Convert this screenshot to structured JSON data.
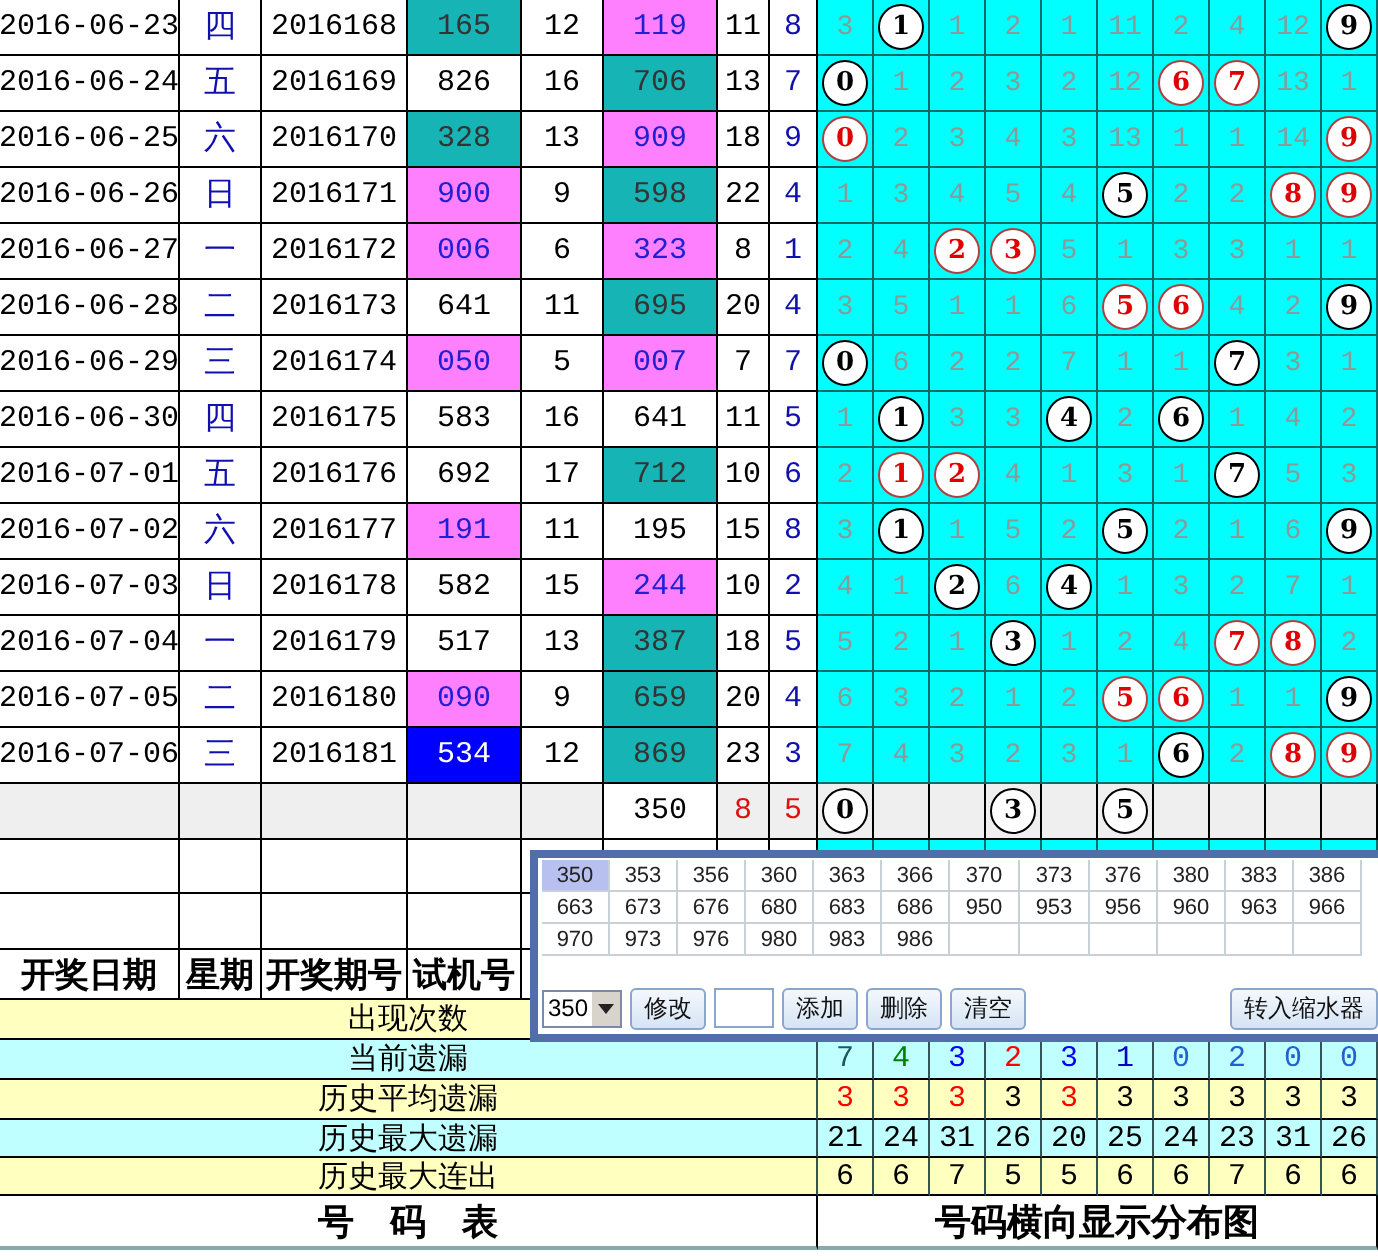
{
  "rows": [
    {
      "date": "2016-06-23",
      "weekday": "四",
      "issue": "2016168",
      "trial": {
        "text": "165",
        "color": "#16b4b4"
      },
      "sum": "12",
      "draw": {
        "text": "119",
        "color": "#ff80ff"
      },
      "span": "11",
      "tail": "8",
      "cells": [
        {
          "kind": "miss",
          "text": "3"
        },
        {
          "kind": "ball",
          "text": "1",
          "red": false
        },
        {
          "kind": "miss",
          "text": "1"
        },
        {
          "kind": "miss",
          "text": "2"
        },
        {
          "kind": "miss",
          "text": "1"
        },
        {
          "kind": "miss",
          "text": "11"
        },
        {
          "kind": "miss",
          "text": "2"
        },
        {
          "kind": "miss",
          "text": "4"
        },
        {
          "kind": "miss",
          "text": "12"
        },
        {
          "kind": "ball",
          "text": "9",
          "red": false
        }
      ]
    },
    {
      "date": "2016-06-24",
      "weekday": "五",
      "issue": "2016169",
      "trial": {
        "text": "826"
      },
      "sum": "16",
      "draw": {
        "text": "706",
        "color": "#16b4b4"
      },
      "span": "13",
      "tail": "7",
      "cells": [
        {
          "kind": "ball",
          "text": "0",
          "red": false
        },
        {
          "kind": "miss",
          "text": "1"
        },
        {
          "kind": "miss",
          "text": "2"
        },
        {
          "kind": "miss",
          "text": "3"
        },
        {
          "kind": "miss",
          "text": "2"
        },
        {
          "kind": "miss",
          "text": "12"
        },
        {
          "kind": "ball",
          "text": "6",
          "red": true
        },
        {
          "kind": "ball",
          "text": "7",
          "red": true
        },
        {
          "kind": "miss",
          "text": "13"
        },
        {
          "kind": "miss",
          "text": "1"
        }
      ]
    },
    {
      "date": "2016-06-25",
      "weekday": "六",
      "issue": "2016170",
      "trial": {
        "text": "328",
        "color": "#16b4b4"
      },
      "sum": "13",
      "draw": {
        "text": "909",
        "color": "#ff80ff"
      },
      "span": "18",
      "tail": "9",
      "cells": [
        {
          "kind": "ball",
          "text": "0",
          "red": true
        },
        {
          "kind": "miss",
          "text": "2"
        },
        {
          "kind": "miss",
          "text": "3"
        },
        {
          "kind": "miss",
          "text": "4"
        },
        {
          "kind": "miss",
          "text": "3"
        },
        {
          "kind": "miss",
          "text": "13"
        },
        {
          "kind": "miss",
          "text": "1"
        },
        {
          "kind": "miss",
          "text": "1"
        },
        {
          "kind": "miss",
          "text": "14"
        },
        {
          "kind": "ball",
          "text": "9",
          "red": true
        }
      ]
    },
    {
      "date": "2016-06-26",
      "weekday": "日",
      "issue": "2016171",
      "trial": {
        "text": "900",
        "color": "#ff80ff"
      },
      "sum": "9",
      "draw": {
        "text": "598",
        "color": "#16b4b4"
      },
      "span": "22",
      "tail": "4",
      "cells": [
        {
          "kind": "miss",
          "text": "1"
        },
        {
          "kind": "miss",
          "text": "3"
        },
        {
          "kind": "miss",
          "text": "4"
        },
        {
          "kind": "miss",
          "text": "5"
        },
        {
          "kind": "miss",
          "text": "4"
        },
        {
          "kind": "ball",
          "text": "5",
          "red": false
        },
        {
          "kind": "miss",
          "text": "2"
        },
        {
          "kind": "miss",
          "text": "2"
        },
        {
          "kind": "ball",
          "text": "8",
          "red": true
        },
        {
          "kind": "ball",
          "text": "9",
          "red": true
        }
      ]
    },
    {
      "date": "2016-06-27",
      "weekday": "一",
      "issue": "2016172",
      "trial": {
        "text": "006",
        "color": "#ff80ff"
      },
      "sum": "6",
      "draw": {
        "text": "323",
        "color": "#ff80ff"
      },
      "span": "8",
      "tail": "1",
      "cells": [
        {
          "kind": "miss",
          "text": "2"
        },
        {
          "kind": "miss",
          "text": "4"
        },
        {
          "kind": "ball",
          "text": "2",
          "red": true
        },
        {
          "kind": "ball",
          "text": "3",
          "red": true
        },
        {
          "kind": "miss",
          "text": "5"
        },
        {
          "kind": "miss",
          "text": "1"
        },
        {
          "kind": "miss",
          "text": "3"
        },
        {
          "kind": "miss",
          "text": "3"
        },
        {
          "kind": "miss",
          "text": "1"
        },
        {
          "kind": "miss",
          "text": "1"
        }
      ]
    },
    {
      "date": "2016-06-28",
      "weekday": "二",
      "issue": "2016173",
      "trial": {
        "text": "641"
      },
      "sum": "11",
      "draw": {
        "text": "695",
        "color": "#16b4b4"
      },
      "span": "20",
      "tail": "4",
      "cells": [
        {
          "kind": "miss",
          "text": "3"
        },
        {
          "kind": "miss",
          "text": "5"
        },
        {
          "kind": "miss",
          "text": "1"
        },
        {
          "kind": "miss",
          "text": "1"
        },
        {
          "kind": "miss",
          "text": "6"
        },
        {
          "kind": "ball",
          "text": "5",
          "red": true
        },
        {
          "kind": "ball",
          "text": "6",
          "red": true
        },
        {
          "kind": "miss",
          "text": "4"
        },
        {
          "kind": "miss",
          "text": "2"
        },
        {
          "kind": "ball",
          "text": "9",
          "red": false
        }
      ]
    },
    {
      "date": "2016-06-29",
      "weekday": "三",
      "issue": "2016174",
      "trial": {
        "text": "050",
        "color": "#ff80ff"
      },
      "sum": "5",
      "draw": {
        "text": "007",
        "color": "#ff80ff"
      },
      "span": "7",
      "tail": "7",
      "cells": [
        {
          "kind": "ball",
          "text": "0",
          "red": false
        },
        {
          "kind": "miss",
          "text": "6"
        },
        {
          "kind": "miss",
          "text": "2"
        },
        {
          "kind": "miss",
          "text": "2"
        },
        {
          "kind": "miss",
          "text": "7"
        },
        {
          "kind": "miss",
          "text": "1"
        },
        {
          "kind": "miss",
          "text": "1"
        },
        {
          "kind": "ball",
          "text": "7",
          "red": false
        },
        {
          "kind": "miss",
          "text": "3"
        },
        {
          "kind": "miss",
          "text": "1"
        }
      ]
    },
    {
      "date": "2016-06-30",
      "weekday": "四",
      "issue": "2016175",
      "trial": {
        "text": "583"
      },
      "sum": "16",
      "draw": {
        "text": "641"
      },
      "span": "11",
      "tail": "5",
      "cells": [
        {
          "kind": "miss",
          "text": "1"
        },
        {
          "kind": "ball",
          "text": "1",
          "red": false
        },
        {
          "kind": "miss",
          "text": "3"
        },
        {
          "kind": "miss",
          "text": "3"
        },
        {
          "kind": "ball",
          "text": "4",
          "red": false
        },
        {
          "kind": "miss",
          "text": "2"
        },
        {
          "kind": "ball",
          "text": "6",
          "red": false
        },
        {
          "kind": "miss",
          "text": "1"
        },
        {
          "kind": "miss",
          "text": "4"
        },
        {
          "kind": "miss",
          "text": "2"
        }
      ]
    },
    {
      "date": "2016-07-01",
      "weekday": "五",
      "issue": "2016176",
      "trial": {
        "text": "692"
      },
      "sum": "17",
      "draw": {
        "text": "712",
        "color": "#16b4b4"
      },
      "span": "10",
      "tail": "6",
      "cells": [
        {
          "kind": "miss",
          "text": "2"
        },
        {
          "kind": "ball",
          "text": "1",
          "red": true
        },
        {
          "kind": "ball",
          "text": "2",
          "red": true
        },
        {
          "kind": "miss",
          "text": "4"
        },
        {
          "kind": "miss",
          "text": "1"
        },
        {
          "kind": "miss",
          "text": "3"
        },
        {
          "kind": "miss",
          "text": "1"
        },
        {
          "kind": "ball",
          "text": "7",
          "red": false
        },
        {
          "kind": "miss",
          "text": "5"
        },
        {
          "kind": "miss",
          "text": "3"
        }
      ]
    },
    {
      "date": "2016-07-02",
      "weekday": "六",
      "issue": "2016177",
      "trial": {
        "text": "191",
        "color": "#ff80ff"
      },
      "sum": "11",
      "draw": {
        "text": "195"
      },
      "span": "15",
      "tail": "8",
      "cells": [
        {
          "kind": "miss",
          "text": "3"
        },
        {
          "kind": "ball",
          "text": "1",
          "red": false
        },
        {
          "kind": "miss",
          "text": "1"
        },
        {
          "kind": "miss",
          "text": "5"
        },
        {
          "kind": "miss",
          "text": "2"
        },
        {
          "kind": "ball",
          "text": "5",
          "red": false
        },
        {
          "kind": "miss",
          "text": "2"
        },
        {
          "kind": "miss",
          "text": "1"
        },
        {
          "kind": "miss",
          "text": "6"
        },
        {
          "kind": "ball",
          "text": "9",
          "red": false
        }
      ]
    },
    {
      "date": "2016-07-03",
      "weekday": "日",
      "issue": "2016178",
      "trial": {
        "text": "582"
      },
      "sum": "15",
      "draw": {
        "text": "244",
        "color": "#ff80ff"
      },
      "span": "10",
      "tail": "2",
      "cells": [
        {
          "kind": "miss",
          "text": "4"
        },
        {
          "kind": "miss",
          "text": "1"
        },
        {
          "kind": "ball",
          "text": "2",
          "red": false
        },
        {
          "kind": "miss",
          "text": "6"
        },
        {
          "kind": "ball",
          "text": "4",
          "red": false
        },
        {
          "kind": "miss",
          "text": "1"
        },
        {
          "kind": "miss",
          "text": "3"
        },
        {
          "kind": "miss",
          "text": "2"
        },
        {
          "kind": "miss",
          "text": "7"
        },
        {
          "kind": "miss",
          "text": "1"
        }
      ]
    },
    {
      "date": "2016-07-04",
      "weekday": "一",
      "issue": "2016179",
      "trial": {
        "text": "517"
      },
      "sum": "13",
      "draw": {
        "text": "387",
        "color": "#16b4b4"
      },
      "span": "18",
      "tail": "5",
      "cells": [
        {
          "kind": "miss",
          "text": "5"
        },
        {
          "kind": "miss",
          "text": "2"
        },
        {
          "kind": "miss",
          "text": "1"
        },
        {
          "kind": "ball",
          "text": "3",
          "red": false
        },
        {
          "kind": "miss",
          "text": "1"
        },
        {
          "kind": "miss",
          "text": "2"
        },
        {
          "kind": "miss",
          "text": "4"
        },
        {
          "kind": "ball",
          "text": "7",
          "red": true
        },
        {
          "kind": "ball",
          "text": "8",
          "red": true
        },
        {
          "kind": "miss",
          "text": "2"
        }
      ]
    },
    {
      "date": "2016-07-05",
      "weekday": "二",
      "issue": "2016180",
      "trial": {
        "text": "090",
        "color": "#ff80ff"
      },
      "sum": "9",
      "draw": {
        "text": "659",
        "color": "#16b4b4"
      },
      "span": "20",
      "tail": "4",
      "cells": [
        {
          "kind": "miss",
          "text": "6"
        },
        {
          "kind": "miss",
          "text": "3"
        },
        {
          "kind": "miss",
          "text": "2"
        },
        {
          "kind": "miss",
          "text": "1"
        },
        {
          "kind": "miss",
          "text": "2"
        },
        {
          "kind": "ball",
          "text": "5",
          "red": true
        },
        {
          "kind": "ball",
          "text": "6",
          "red": true
        },
        {
          "kind": "miss",
          "text": "1"
        },
        {
          "kind": "miss",
          "text": "1"
        },
        {
          "kind": "ball",
          "text": "9",
          "red": false
        }
      ]
    },
    {
      "date": "2016-07-06",
      "weekday": "三",
      "issue": "2016181",
      "trial": {
        "text": "534",
        "color": "#0000ff"
      },
      "sum": "12",
      "draw": {
        "text": "869",
        "color": "#16b4b4"
      },
      "span": "23",
      "tail": "3",
      "cells": [
        {
          "kind": "miss",
          "text": "7"
        },
        {
          "kind": "miss",
          "text": "4"
        },
        {
          "kind": "miss",
          "text": "3"
        },
        {
          "kind": "miss",
          "text": "2"
        },
        {
          "kind": "miss",
          "text": "3"
        },
        {
          "kind": "miss",
          "text": "1"
        },
        {
          "kind": "ball",
          "text": "6",
          "red": false
        },
        {
          "kind": "miss",
          "text": "2"
        },
        {
          "kind": "ball",
          "text": "8",
          "red": true
        },
        {
          "kind": "ball",
          "text": "9",
          "red": true
        }
      ]
    }
  ],
  "summary_row": {
    "draw": "350",
    "span": "8",
    "tail": "5",
    "cells": [
      {
        "kind": "ball",
        "text": "0",
        "red": false
      },
      {
        "kind": "empty"
      },
      {
        "kind": "empty"
      },
      {
        "kind": "ball",
        "text": "3",
        "red": false
      },
      {
        "kind": "empty"
      },
      {
        "kind": "ball",
        "text": "5",
        "red": false
      },
      {
        "kind": "empty"
      },
      {
        "kind": "empty"
      },
      {
        "kind": "empty"
      },
      {
        "kind": "empty"
      }
    ]
  },
  "headers": [
    "开奖日期",
    "星期",
    "开奖期号",
    "试机号"
  ],
  "stats": [
    {
      "label": "出现次数"
    },
    {
      "label": "当前遗漏",
      "values": [
        {
          "text": "7",
          "color": "#1a5a5a"
        },
        {
          "text": "4",
          "color": "#008000"
        },
        {
          "text": "3",
          "color": "#0000ff"
        },
        {
          "text": "2",
          "color": "#ff0000"
        },
        {
          "text": "3",
          "color": "#0000ff"
        },
        {
          "text": "1",
          "color": "#0000c0"
        },
        {
          "text": "0",
          "color": "#2060d0"
        },
        {
          "text": "2",
          "color": "#2060d0"
        },
        {
          "text": "0",
          "color": "#2060d0"
        },
        {
          "text": "0",
          "color": "#2060d0"
        }
      ]
    },
    {
      "label": "历史平均遗漏",
      "values": [
        {
          "text": "3",
          "color": "#ff0000"
        },
        {
          "text": "3",
          "color": "#ff0000"
        },
        {
          "text": "3",
          "color": "#ff0000"
        },
        {
          "text": "3",
          "color": "#000000"
        },
        {
          "text": "3",
          "color": "#ff0000"
        },
        {
          "text": "3",
          "color": "#000000"
        },
        {
          "text": "3",
          "color": "#000000"
        },
        {
          "text": "3",
          "color": "#000000"
        },
        {
          "text": "3",
          "color": "#000000"
        },
        {
          "text": "3",
          "color": "#000000"
        }
      ]
    },
    {
      "label": "历史最大遗漏",
      "values": [
        {
          "text": "21"
        },
        {
          "text": "24"
        },
        {
          "text": "31"
        },
        {
          "text": "26"
        },
        {
          "text": "20"
        },
        {
          "text": "25"
        },
        {
          "text": "24"
        },
        {
          "text": "23"
        },
        {
          "text": "31"
        },
        {
          "text": "26"
        }
      ]
    },
    {
      "label": "历史最大连出",
      "values": [
        {
          "text": "6"
        },
        {
          "text": "6"
        },
        {
          "text": "7"
        },
        {
          "text": "5"
        },
        {
          "text": "5"
        },
        {
          "text": "6"
        },
        {
          "text": "6"
        },
        {
          "text": "7"
        },
        {
          "text": "6"
        },
        {
          "text": "6"
        }
      ]
    }
  ],
  "footer": [
    "号　码　表",
    "号码横向显示分布图"
  ],
  "popup": {
    "numbers": [
      {
        "text": "350",
        "selected": true
      },
      {
        "text": "353",
        "selected": false
      },
      {
        "text": "356",
        "selected": false
      },
      {
        "text": "360",
        "selected": false
      },
      {
        "text": "363",
        "selected": false
      },
      {
        "text": "366",
        "selected": false
      },
      {
        "text": "370",
        "selected": false
      },
      {
        "text": "373",
        "selected": false
      },
      {
        "text": "376",
        "selected": false
      },
      {
        "text": "380",
        "selected": false
      },
      {
        "text": "383",
        "selected": false
      },
      {
        "text": "386",
        "selected": false
      },
      {
        "text": "663",
        "selected": false
      },
      {
        "text": "673",
        "selected": false
      },
      {
        "text": "676",
        "selected": false
      },
      {
        "text": "680",
        "selected": false
      },
      {
        "text": "683",
        "selected": false
      },
      {
        "text": "686",
        "selected": false
      },
      {
        "text": "950",
        "selected": false
      },
      {
        "text": "953",
        "selected": false
      },
      {
        "text": "956",
        "selected": false
      },
      {
        "text": "960",
        "selected": false
      },
      {
        "text": "963",
        "selected": false
      },
      {
        "text": "966",
        "selected": false
      },
      {
        "text": "970",
        "selected": false
      },
      {
        "text": "973",
        "selected": false
      },
      {
        "text": "976",
        "selected": false
      },
      {
        "text": "980",
        "selected": false
      },
      {
        "text": "983",
        "selected": false
      },
      {
        "text": "986",
        "selected": false
      }
    ],
    "select_value": "350",
    "edit_button": "修改",
    "action_buttons": [
      "添加",
      "删除",
      "清空"
    ],
    "transfer_button": "转入缩水器"
  }
}
